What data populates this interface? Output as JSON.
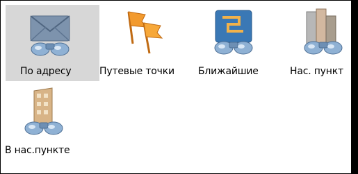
{
  "menu": {
    "items": [
      {
        "label": "По адресу",
        "icon": "envelope-binoculars-icon",
        "selected": true
      },
      {
        "label": "Путевые точки",
        "icon": "flags-binoculars-icon",
        "selected": false
      },
      {
        "label": "Ближайшие",
        "icon": "map-binoculars-icon",
        "selected": false
      },
      {
        "label": "Нас. пункт",
        "icon": "city-binoculars-icon",
        "selected": false
      },
      {
        "label": "В нас.пункте",
        "icon": "building-binoculars-icon",
        "selected": false
      }
    ]
  },
  "colors": {
    "selection_bg": "#d7d7d7",
    "binocular": "#8fb1d4",
    "flag": "#f29a2e",
    "map": "#3a78b5",
    "envelope": "#7d93ad",
    "building": "#b7a58a"
  }
}
